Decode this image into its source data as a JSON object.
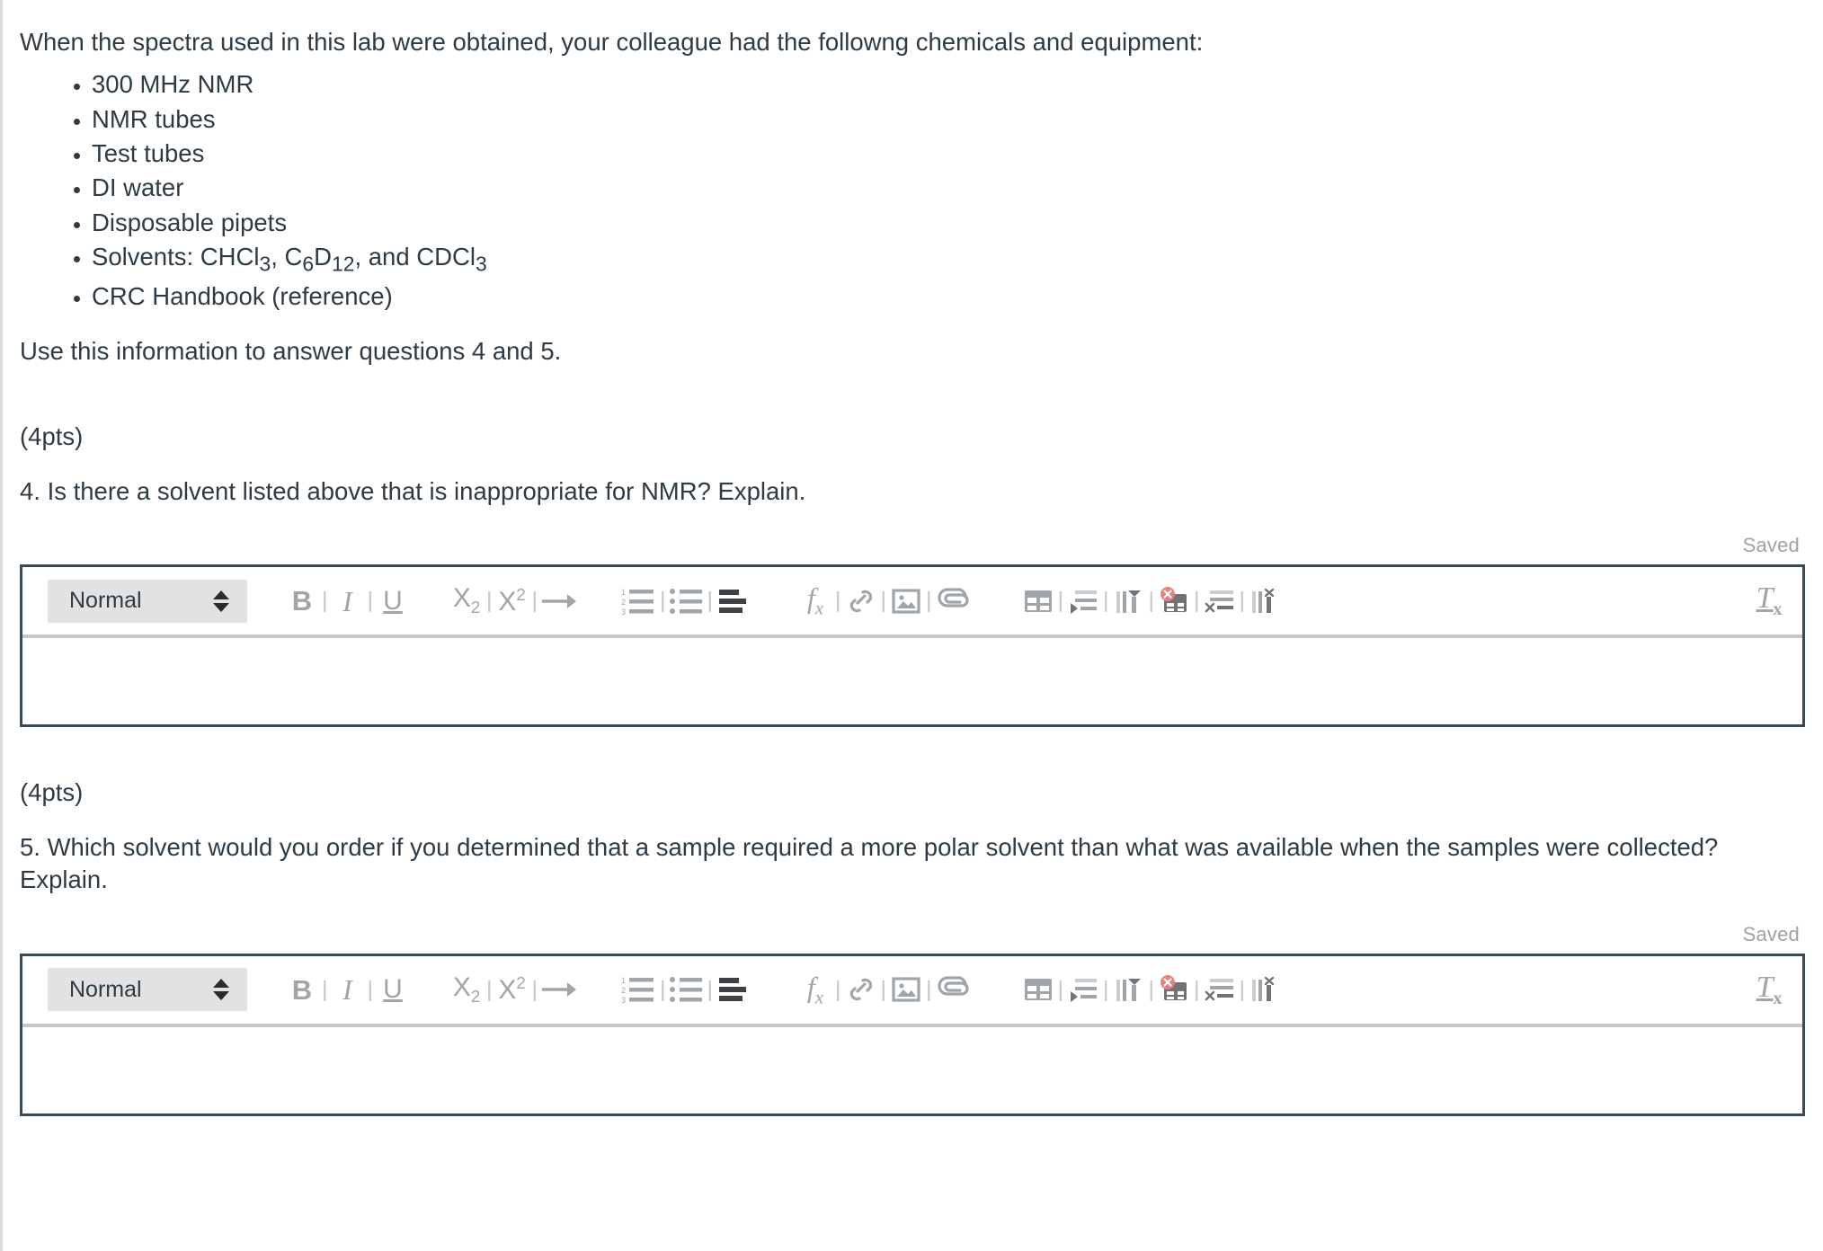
{
  "intro": {
    "paragraph": "When the spectra used in this lab were obtained, your colleague had the followng chemicals and equipment:",
    "equipment": [
      "300 MHz NMR",
      "NMR tubes",
      "Test tubes",
      "DI water",
      "Disposable pipets",
      "CRC Handbook (reference)"
    ],
    "solvents_prefix": "Solvents: CHCl",
    "solvents_sub1": "3",
    "solvents_mid1": ", C",
    "solvents_sub2": "6",
    "solvents_mid2": "D",
    "solvents_sub3": "12",
    "solvents_mid3": ", and CDCl",
    "solvents_sub4": "3",
    "use_info": "Use this information to answer questions 4 and 5."
  },
  "questions": [
    {
      "points_label": "(4pts)",
      "text": "4. Is there a solvent listed above that is inappropriate for NMR? Explain.",
      "status": "Saved",
      "editor": {
        "format_value": "Normal",
        "body_value": ""
      }
    },
    {
      "points_label": "(4pts)",
      "text": "5. Which solvent would you order if you determined that a sample required a more polar solvent than what was available when the samples were collected? Explain.",
      "status": "Saved",
      "editor": {
        "format_value": "Normal",
        "body_value": ""
      }
    }
  ],
  "toolbar": {
    "bold": "B",
    "italic": "I",
    "underline": "U",
    "subscript_base": "X",
    "subscript_sub": "2",
    "superscript_base": "X",
    "superscript_sup": "2",
    "fx_base": "f",
    "fx_sub": "x",
    "clear_base": "T",
    "clear_sub": "x",
    "separator": "|"
  },
  "colors": {
    "text": "#2d3b45",
    "muted": "#9aa3a8",
    "icon": "#9fa5a8",
    "icon_dark": "#58595b",
    "border": "#394b58",
    "toolbar_divider": "#c7c7c7",
    "select_bg": "#e2e2e2",
    "danger": "#e8807d"
  }
}
